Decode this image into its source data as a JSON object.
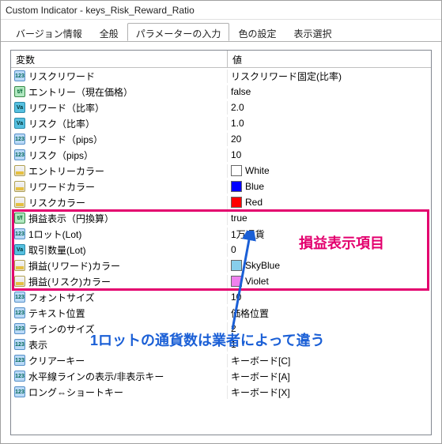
{
  "window_title": "Custom Indicator - keys_Risk_Reward_Ratio",
  "tabs": {
    "t0": "バージョン情報",
    "t1": "全般",
    "t2": "パラメーターの入力",
    "t3": "色の設定",
    "t4": "表示選択"
  },
  "headers": {
    "var": "変数",
    "val": "値"
  },
  "rows": [
    {
      "icon": "123",
      "name": "リスクリワード",
      "value": "リスクリワード固定(比率)"
    },
    {
      "icon": "tf",
      "name": "エントリー（現在価格）",
      "value": "false"
    },
    {
      "icon": "va",
      "name": "リワード（比率）",
      "value": "2.0"
    },
    {
      "icon": "va",
      "name": "リスク（比率）",
      "value": "1.0"
    },
    {
      "icon": "123",
      "name": "リワード（pips）",
      "value": "20"
    },
    {
      "icon": "123",
      "name": "リスク（pips）",
      "value": "10"
    },
    {
      "icon": "clr",
      "name": "エントリーカラー",
      "value": "White",
      "swatch": "#ffffff"
    },
    {
      "icon": "clr",
      "name": "リワードカラー",
      "value": "Blue",
      "swatch": "#0000ff"
    },
    {
      "icon": "clr",
      "name": "リスクカラー",
      "value": "Red",
      "swatch": "#ff0000"
    },
    {
      "icon": "tf",
      "name": "損益表示（円換算）",
      "value": "true"
    },
    {
      "icon": "123",
      "name": "1ロット(Lot)",
      "value": "1万通貨"
    },
    {
      "icon": "va",
      "name": "取引数量(Lot)",
      "value": "0"
    },
    {
      "icon": "clr",
      "name": "損益(リワード)カラー",
      "value": "SkyBlue",
      "swatch": "#87ceeb"
    },
    {
      "icon": "clr",
      "name": "損益(リスク)カラー",
      "value": "Violet",
      "swatch": "#ee82ee"
    },
    {
      "icon": "123",
      "name": "フォントサイズ",
      "value": "10"
    },
    {
      "icon": "123",
      "name": "テキスト位置",
      "value": "価格位置"
    },
    {
      "icon": "123",
      "name": "ラインのサイズ",
      "value": "2"
    },
    {
      "icon": "123",
      "name": "表示",
      "value": "1"
    },
    {
      "icon": "123",
      "name": "クリアーキー",
      "value": "キーボード[C]"
    },
    {
      "icon": "123",
      "name": "水平線ラインの表示/非表示キー",
      "value": "キーボード[A]"
    },
    {
      "icon": "123",
      "name": "ロング⇔ショートキー",
      "value": "キーボード[X]"
    }
  ],
  "annotations": {
    "heading": "損益表示項目",
    "note": "1ロットの通貨数は業者によって違う"
  }
}
